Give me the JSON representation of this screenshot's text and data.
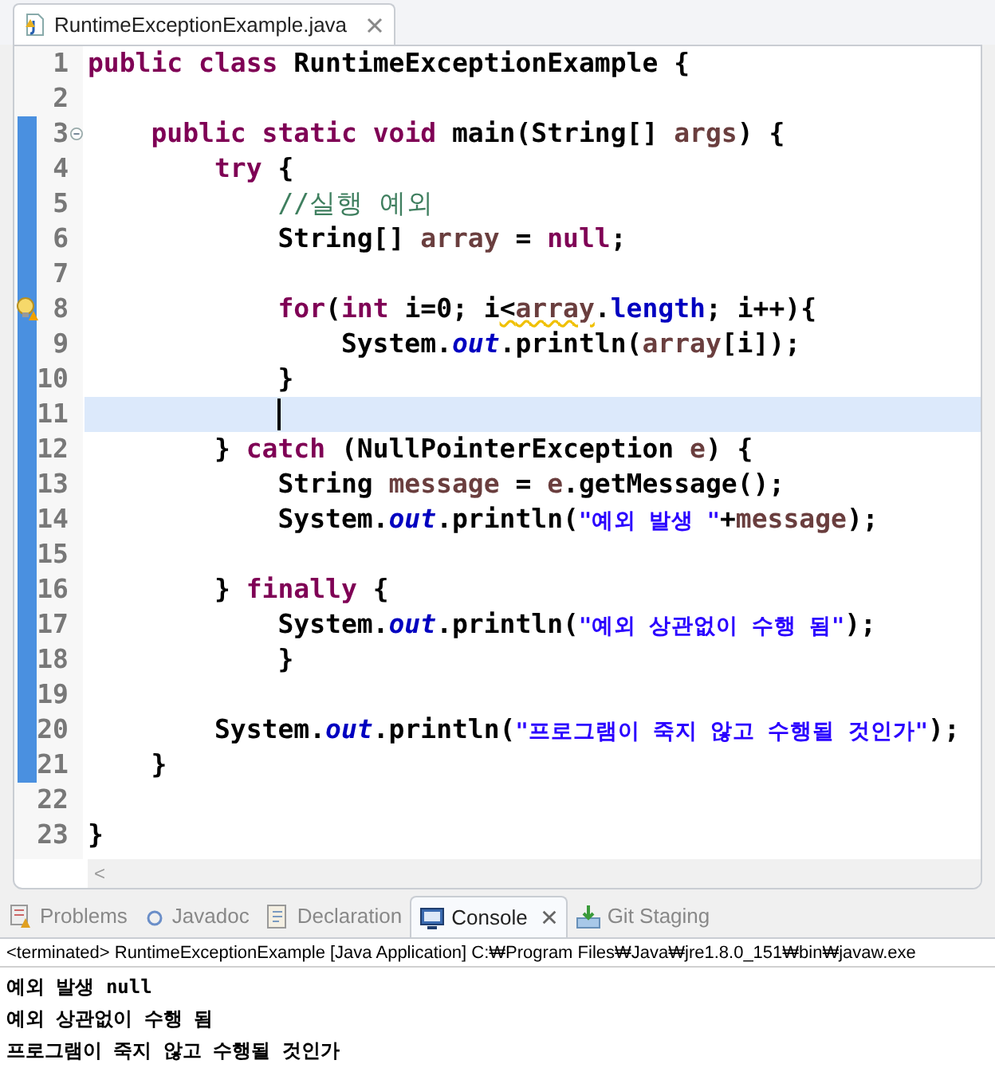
{
  "editor_tab": {
    "title": "RuntimeExceptionExample.java",
    "selected": true
  },
  "lines": [
    {
      "number": "1",
      "changed": false,
      "fold_toggle": false,
      "warning": false,
      "current": false,
      "tokens": [
        {
          "kind": "keyword",
          "text": "public"
        },
        {
          "kind": "keyword",
          "text": " class"
        },
        {
          "kind": "plain",
          "text": " RuntimeExceptionExample {"
        }
      ]
    },
    {
      "number": "2",
      "changed": false,
      "fold_toggle": false,
      "warning": false,
      "current": false
    },
    {
      "number": "3",
      "changed": true,
      "fold_toggle": true,
      "warning": false,
      "current": false,
      "tokens": [
        {
          "kind": "keyword",
          "text": "    public"
        },
        {
          "kind": "keyword",
          "text": " static"
        },
        {
          "kind": "keyword",
          "text": " void"
        },
        {
          "kind": "plain",
          "text": " main(String[] "
        },
        {
          "kind": "local",
          "text": "args"
        },
        {
          "kind": "plain",
          "text": ") {"
        }
      ]
    },
    {
      "number": "4",
      "changed": true,
      "fold_toggle": false,
      "warning": false,
      "current": false,
      "tokens": [
        {
          "kind": "keyword",
          "text": "        try"
        },
        {
          "kind": "plain",
          "text": " {"
        }
      ]
    },
    {
      "number": "5",
      "changed": true,
      "fold_toggle": false,
      "warning": false,
      "current": false,
      "tokens": [
        {
          "kind": "comment",
          "text": "            //실행 예외"
        }
      ]
    },
    {
      "number": "6",
      "changed": true,
      "fold_toggle": false,
      "warning": false,
      "current": false,
      "tokens": [
        {
          "kind": "plain",
          "text": "            String[] "
        },
        {
          "kind": "local",
          "text": "array"
        },
        {
          "kind": "plain",
          "text": " = "
        },
        {
          "kind": "keyword",
          "text": "null"
        },
        {
          "kind": "plain",
          "text": ";"
        }
      ]
    },
    {
      "number": "7",
      "changed": true,
      "fold_toggle": false,
      "warning": false,
      "current": false
    },
    {
      "number": "8",
      "changed": true,
      "fold_toggle": false,
      "warning": true,
      "current": false,
      "tokens": [
        {
          "kind": "keyword",
          "text": "            for"
        },
        {
          "kind": "plain",
          "text": "("
        },
        {
          "kind": "keyword",
          "text": "int"
        },
        {
          "kind": "plain",
          "text": " i=0; i"
        },
        {
          "kind": "warning",
          "text": "<"
        },
        {
          "kind": "local_warning",
          "text": "array"
        },
        {
          "kind": "plain",
          "text": "."
        },
        {
          "kind": "field",
          "text": "length"
        },
        {
          "kind": "plain",
          "text": "; i++){"
        }
      ]
    },
    {
      "number": "9",
      "changed": true,
      "fold_toggle": false,
      "warning": false,
      "current": false,
      "tokens": [
        {
          "kind": "plain",
          "text": "                System."
        },
        {
          "kind": "static_field",
          "text": "out"
        },
        {
          "kind": "plain",
          "text": ".println("
        },
        {
          "kind": "local",
          "text": "array"
        },
        {
          "kind": "plain",
          "text": "[i]);"
        }
      ]
    },
    {
      "number": "10",
      "changed": true,
      "fold_toggle": false,
      "warning": false,
      "current": false,
      "tokens": [
        {
          "kind": "plain",
          "text": "            }"
        }
      ]
    },
    {
      "number": "11",
      "changed": true,
      "fold_toggle": false,
      "warning": false,
      "current": true
    },
    {
      "number": "12",
      "changed": true,
      "fold_toggle": false,
      "warning": false,
      "current": false,
      "tokens": [
        {
          "kind": "plain",
          "text": "        } "
        },
        {
          "kind": "keyword",
          "text": "catch"
        },
        {
          "kind": "plain",
          "text": " (NullPointerException "
        },
        {
          "kind": "local",
          "text": "e"
        },
        {
          "kind": "plain",
          "text": ") {"
        }
      ]
    },
    {
      "number": "13",
      "changed": true,
      "fold_toggle": false,
      "warning": false,
      "current": false,
      "tokens": [
        {
          "kind": "plain",
          "text": "            String "
        },
        {
          "kind": "local",
          "text": "message"
        },
        {
          "kind": "plain",
          "text": " = "
        },
        {
          "kind": "local",
          "text": "e"
        },
        {
          "kind": "plain",
          "text": ".getMessage();"
        }
      ]
    },
    {
      "number": "14",
      "changed": true,
      "fold_toggle": false,
      "warning": false,
      "current": false,
      "tokens": [
        {
          "kind": "plain",
          "text": "            System."
        },
        {
          "kind": "static_field",
          "text": "out"
        },
        {
          "kind": "plain",
          "text": ".println("
        },
        {
          "kind": "string",
          "text": "\"예외 발생 \""
        },
        {
          "kind": "plain",
          "text": "+"
        },
        {
          "kind": "local",
          "text": "message"
        },
        {
          "kind": "plain",
          "text": ");"
        }
      ]
    },
    {
      "number": "15",
      "changed": true,
      "fold_toggle": false,
      "warning": false,
      "current": false
    },
    {
      "number": "16",
      "changed": true,
      "fold_toggle": false,
      "warning": false,
      "current": false,
      "tokens": [
        {
          "kind": "plain",
          "text": "        } "
        },
        {
          "kind": "keyword",
          "text": "finally"
        },
        {
          "kind": "plain",
          "text": " {"
        }
      ]
    },
    {
      "number": "17",
      "changed": true,
      "fold_toggle": false,
      "warning": false,
      "current": false,
      "tokens": [
        {
          "kind": "plain",
          "text": "            System."
        },
        {
          "kind": "static_field",
          "text": "out"
        },
        {
          "kind": "plain",
          "text": ".println("
        },
        {
          "kind": "string",
          "text": "\"예외 상관없이 수행 됨\""
        },
        {
          "kind": "plain",
          "text": ");"
        }
      ]
    },
    {
      "number": "18",
      "changed": true,
      "fold_toggle": false,
      "warning": false,
      "current": false,
      "tokens": [
        {
          "kind": "plain",
          "text": "            }"
        }
      ]
    },
    {
      "number": "19",
      "changed": true,
      "fold_toggle": false,
      "warning": false,
      "current": false
    },
    {
      "number": "20",
      "changed": true,
      "fold_toggle": false,
      "warning": false,
      "current": false,
      "tokens": [
        {
          "kind": "plain",
          "text": "        System."
        },
        {
          "kind": "static_field",
          "text": "out"
        },
        {
          "kind": "plain",
          "text": ".println("
        },
        {
          "kind": "string",
          "text": "\"프로그램이 죽지 않고 수행될 것인가\""
        },
        {
          "kind": "plain",
          "text": ");"
        }
      ]
    },
    {
      "number": "21",
      "changed": true,
      "fold_toggle": false,
      "warning": false,
      "current": false,
      "tokens": [
        {
          "kind": "plain",
          "text": "    }"
        }
      ]
    },
    {
      "number": "22",
      "changed": false,
      "fold_toggle": false,
      "warning": false,
      "current": false
    },
    {
      "number": "23",
      "changed": false,
      "fold_toggle": false,
      "warning": false,
      "current": false,
      "tokens": [
        {
          "kind": "plain",
          "text": "}"
        }
      ]
    }
  ],
  "scroll_left": "<",
  "panel_tabs": [
    {
      "label": "Problems",
      "kind": "problems",
      "selected": false
    },
    {
      "label": "Javadoc",
      "kind": "javadoc",
      "selected": false
    },
    {
      "label": "Declaration",
      "kind": "declaration",
      "selected": false
    },
    {
      "label": "Console",
      "kind": "console",
      "selected": true
    },
    {
      "label": "Git Staging",
      "kind": "git",
      "selected": false
    }
  ],
  "console": {
    "header": "<terminated> RuntimeExceptionExample [Java Application] C:₩Program Files₩Java₩jre1.8.0_151₩bin₩javaw.exe",
    "output": [
      "예외 발생 null",
      "예외 상관없이 수행 됨",
      "프로그램이 죽지 않고 수행될 것인가"
    ]
  }
}
